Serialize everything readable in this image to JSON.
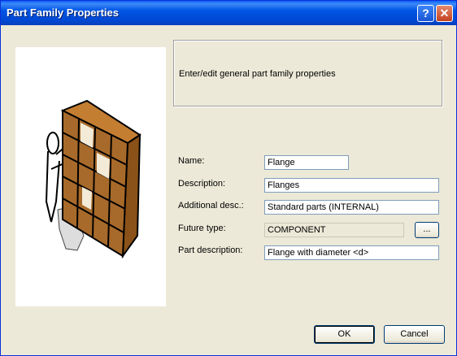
{
  "window": {
    "title": "Part Family Properties",
    "help_label": "?",
    "close_label": "✕"
  },
  "info": {
    "text": "Enter/edit general part family properties"
  },
  "fields": {
    "name": {
      "label": "Name:",
      "value": "Flange"
    },
    "description": {
      "label": "Description:",
      "value": "Flanges"
    },
    "additional_desc": {
      "label": "Additional desc.:",
      "value": "Standard parts (INTERNAL)"
    },
    "future_type": {
      "label": "Future type:",
      "value": "COMPONENT",
      "browse_label": "..."
    },
    "part_description": {
      "label": "Part description:",
      "value": "Flange with diameter <d>"
    }
  },
  "buttons": {
    "ok": "OK",
    "cancel": "Cancel"
  },
  "colors": {
    "titlebar": "#0054e3",
    "face": "#ece9d8",
    "shelf": "#a86a2a"
  }
}
